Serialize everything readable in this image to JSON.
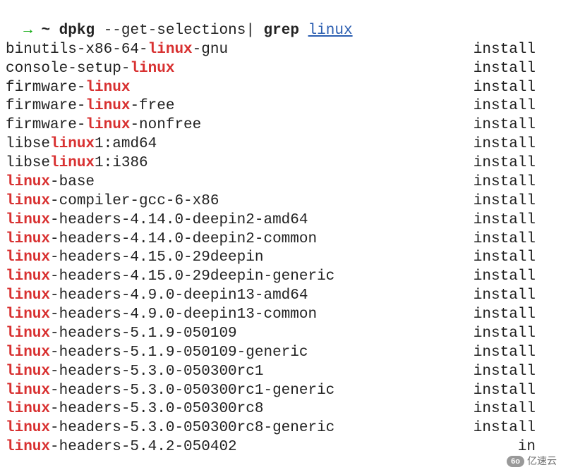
{
  "prompt": {
    "arrow": "→",
    "path": "~",
    "cmd1": "dpkg",
    "flag": "--get-selections",
    "pipe": "|",
    "cmd2": "grep",
    "arg": "linux"
  },
  "highlight_term": "linux",
  "status_label": "install",
  "last_status_truncated": "in",
  "packages": [
    "binutils-x86-64-linux-gnu",
    "console-setup-linux",
    "firmware-linux",
    "firmware-linux-free",
    "firmware-linux-nonfree",
    "libselinux1:amd64",
    "libselinux1:i386",
    "linux-base",
    "linux-compiler-gcc-6-x86",
    "linux-headers-4.14.0-deepin2-amd64",
    "linux-headers-4.14.0-deepin2-common",
    "linux-headers-4.15.0-29deepin",
    "linux-headers-4.15.0-29deepin-generic",
    "linux-headers-4.9.0-deepin13-amd64",
    "linux-headers-4.9.0-deepin13-common",
    "linux-headers-5.1.9-050109",
    "linux-headers-5.1.9-050109-generic",
    "linux-headers-5.3.0-050300rc1",
    "linux-headers-5.3.0-050300rc1-generic",
    "linux-headers-5.3.0-050300rc8",
    "linux-headers-5.3.0-050300rc8-generic",
    "linux-headers-5.4.2-050402"
  ],
  "watermark": {
    "badge": "6o",
    "text": "亿速云"
  }
}
